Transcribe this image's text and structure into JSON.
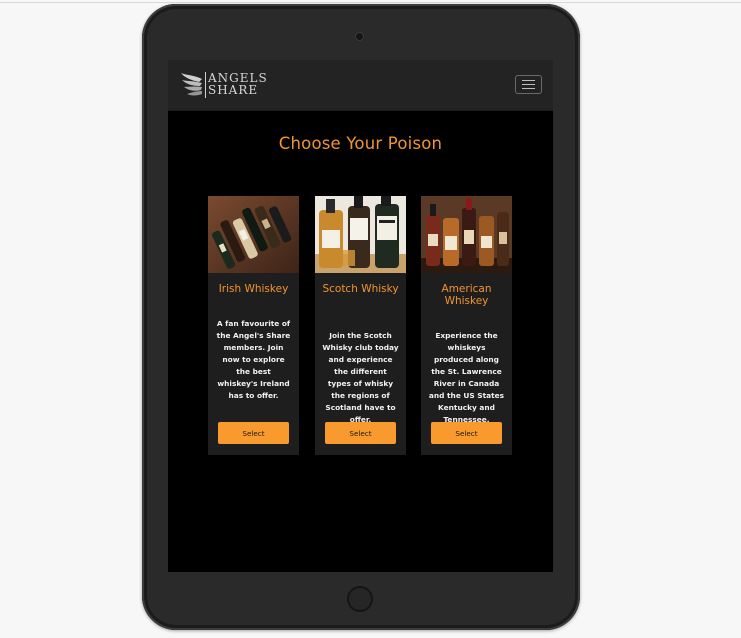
{
  "brand": {
    "logo_line1": "ANGELS",
    "logo_line2": "SHARE"
  },
  "navbar": {
    "toggle_icon": "hamburger-icon"
  },
  "page": {
    "heading": "Choose Your Poison"
  },
  "cards": [
    {
      "title": "Irish Whiskey",
      "description": "A fan favourite of the Angel's Share members. Join now to explore the best whiskey's Ireland has to offer.",
      "button_label": "Select"
    },
    {
      "title": "Scotch Whisky",
      "description": "Join the Scotch Whisky club today and experience the different types of whisky the regions of Scotland have to offer.",
      "button_label": "Select"
    },
    {
      "title": "American Whiskey",
      "description": "Experience the whiskeys produced along the St. Lawrence River in Canada and the US States Kentucky and Tennessee.",
      "button_label": "Select"
    }
  ],
  "colors": {
    "accent": "#f3952e",
    "button": "#f89a2e",
    "navbar": "#232323",
    "card": "#1e1e1e",
    "screen": "#000000"
  }
}
